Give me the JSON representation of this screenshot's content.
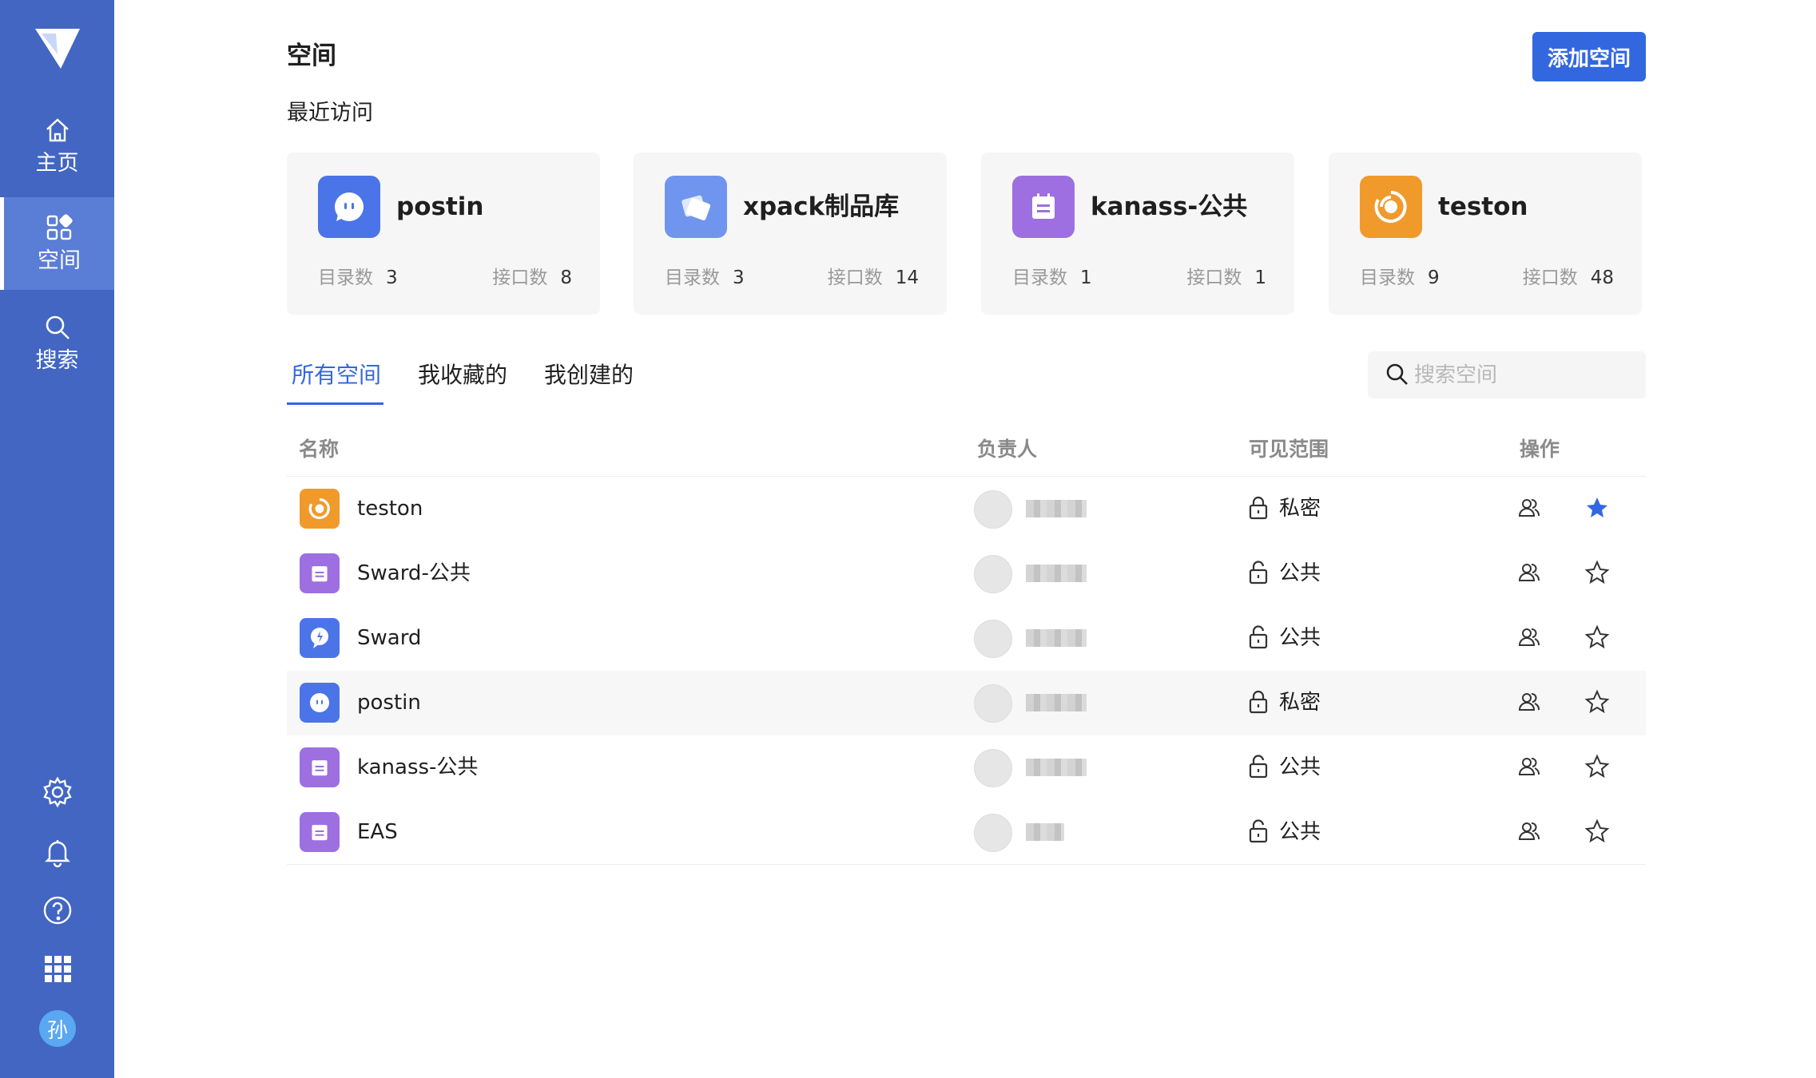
{
  "sidebar": {
    "items": [
      {
        "label": "主页",
        "icon": "home-icon"
      },
      {
        "label": "空间",
        "icon": "space-icon"
      },
      {
        "label": "搜索",
        "icon": "search-icon"
      }
    ],
    "bottom_icons": [
      "settings-icon",
      "bell-icon",
      "help-icon",
      "apps-grid-icon"
    ],
    "avatar_text": "孙"
  },
  "header": {
    "title": "空间",
    "add_button": "添加空间"
  },
  "recent": {
    "title": "最近访问",
    "dir_label": "目录数",
    "api_label": "接口数",
    "cards": [
      {
        "name": "postin",
        "dirs": "3",
        "apis": "8",
        "color": "#4b74e8",
        "icon": "robot-icon"
      },
      {
        "name": "xpack制品库",
        "dirs": "3",
        "apis": "14",
        "color": "#6f95ee",
        "icon": "package-icon"
      },
      {
        "name": "kanass-公共",
        "dirs": "1",
        "apis": "1",
        "color": "#9d6fe0",
        "icon": "calendar-icon"
      },
      {
        "name": "teston",
        "dirs": "9",
        "apis": "48",
        "color": "#f09a2c",
        "icon": "target-icon"
      }
    ]
  },
  "tabs": [
    {
      "label": "所有空间",
      "active": true
    },
    {
      "label": "我收藏的",
      "active": false
    },
    {
      "label": "我创建的",
      "active": false
    }
  ],
  "search": {
    "placeholder": "搜索空间"
  },
  "table": {
    "columns": [
      "名称",
      "负责人",
      "可见范围",
      "操作"
    ],
    "rows": [
      {
        "name": "teston",
        "icon": "target-icon",
        "color": "#f09a2c",
        "visibility": "私密",
        "lock": "closed",
        "starred": true
      },
      {
        "name": "Sward-公共",
        "icon": "calendar-icon",
        "color": "#9d6fe0",
        "visibility": "公共",
        "lock": "open",
        "starred": false
      },
      {
        "name": "Sward",
        "icon": "pin-icon",
        "color": "#4b74e8",
        "visibility": "公共",
        "lock": "open",
        "starred": false
      },
      {
        "name": "postin",
        "icon": "robot-icon",
        "color": "#4b74e8",
        "visibility": "私密",
        "lock": "closed",
        "starred": false
      },
      {
        "name": "kanass-公共",
        "icon": "calendar-icon",
        "color": "#9d6fe0",
        "visibility": "公共",
        "lock": "open",
        "starred": false
      },
      {
        "name": "EAS",
        "icon": "calendar-icon",
        "color": "#9d6fe0",
        "visibility": "公共",
        "lock": "open",
        "starred": false
      }
    ]
  },
  "colors": {
    "sidebar": "#4266c2",
    "accent": "#3367e0",
    "star_active": "#3367e0"
  }
}
